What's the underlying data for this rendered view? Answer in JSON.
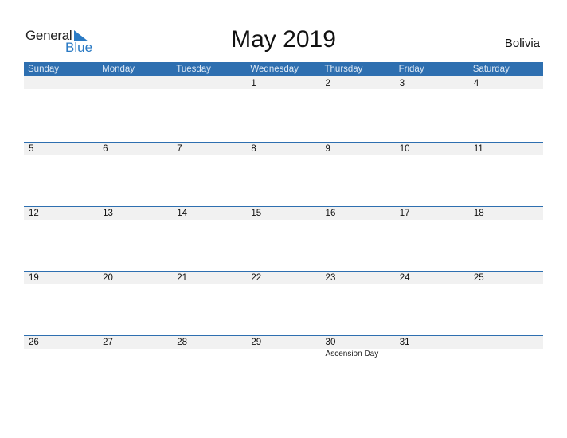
{
  "logo": {
    "general": "General",
    "blue": "Blue"
  },
  "title": "May 2019",
  "country": "Bolivia",
  "colors": {
    "header": "#2e6fb0",
    "stripe": "#f1f1f1",
    "brand": "#2a7ac4"
  },
  "weekdays": [
    "Sunday",
    "Monday",
    "Tuesday",
    "Wednesday",
    "Thursday",
    "Friday",
    "Saturday"
  ],
  "weeks": [
    [
      "",
      "",
      "",
      "1",
      "2",
      "3",
      "4"
    ],
    [
      "5",
      "6",
      "7",
      "8",
      "9",
      "10",
      "11"
    ],
    [
      "12",
      "13",
      "14",
      "15",
      "16",
      "17",
      "18"
    ],
    [
      "19",
      "20",
      "21",
      "22",
      "23",
      "24",
      "25"
    ],
    [
      "26",
      "27",
      "28",
      "29",
      "30",
      "31",
      ""
    ]
  ],
  "holidays": {
    "4": {
      "4": "Ascension Day"
    }
  }
}
